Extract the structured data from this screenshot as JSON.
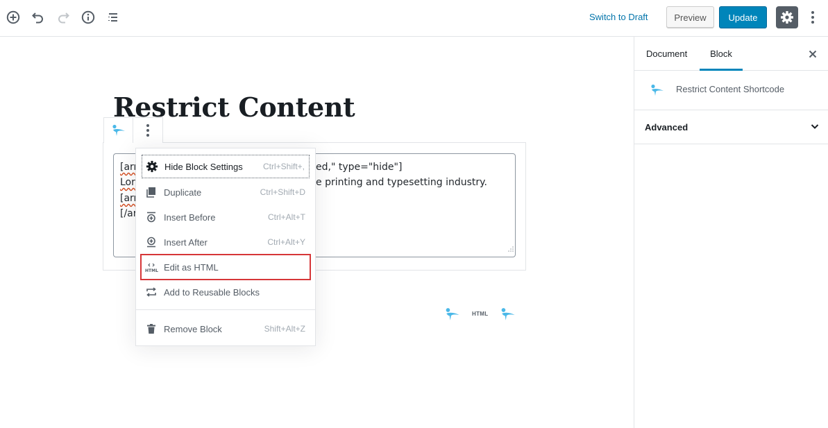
{
  "toolbar": {
    "switch_to_draft": "Switch to Draft",
    "preview": "Preview",
    "update": "Update"
  },
  "editor": {
    "post_title": "Restrict Content",
    "code_lines": [
      "[arr",
      "Lor",
      "[arr",
      "[/ar"
    ],
    "code_fragments": {
      "line1_right": "ed,\"  type=\"hide\"]",
      "line2_right": "e printing and typesetting industry."
    },
    "html_inserter_label": "HTML"
  },
  "block_menu": {
    "items": [
      {
        "label": "Hide Block Settings",
        "shortcut": "Ctrl+Shift+,",
        "icon": "gear-icon"
      },
      {
        "label": "Duplicate",
        "shortcut": "Ctrl+Shift+D",
        "icon": "duplicate-icon"
      },
      {
        "label": "Insert Before",
        "shortcut": "Ctrl+Alt+T",
        "icon": "insert-before-icon"
      },
      {
        "label": "Insert After",
        "shortcut": "Ctrl+Alt+Y",
        "icon": "insert-after-icon"
      },
      {
        "label": "Edit as HTML",
        "shortcut": "",
        "icon": "html-icon"
      },
      {
        "label": "Add to Reusable Blocks",
        "shortcut": "",
        "icon": "reusable-icon"
      },
      {
        "label": "Remove Block",
        "shortcut": "Shift+Alt+Z",
        "icon": "trash-icon"
      }
    ]
  },
  "sidebar": {
    "tabs": [
      "Document",
      "Block"
    ],
    "active_tab": "Block",
    "block_name": "Restrict Content Shortcode",
    "panels": [
      {
        "title": "Advanced"
      }
    ]
  },
  "colors": {
    "accent": "#0085ba",
    "link": "#0073aa",
    "block_icon": "#4ab8e8",
    "highlight_box": "#d63638"
  }
}
